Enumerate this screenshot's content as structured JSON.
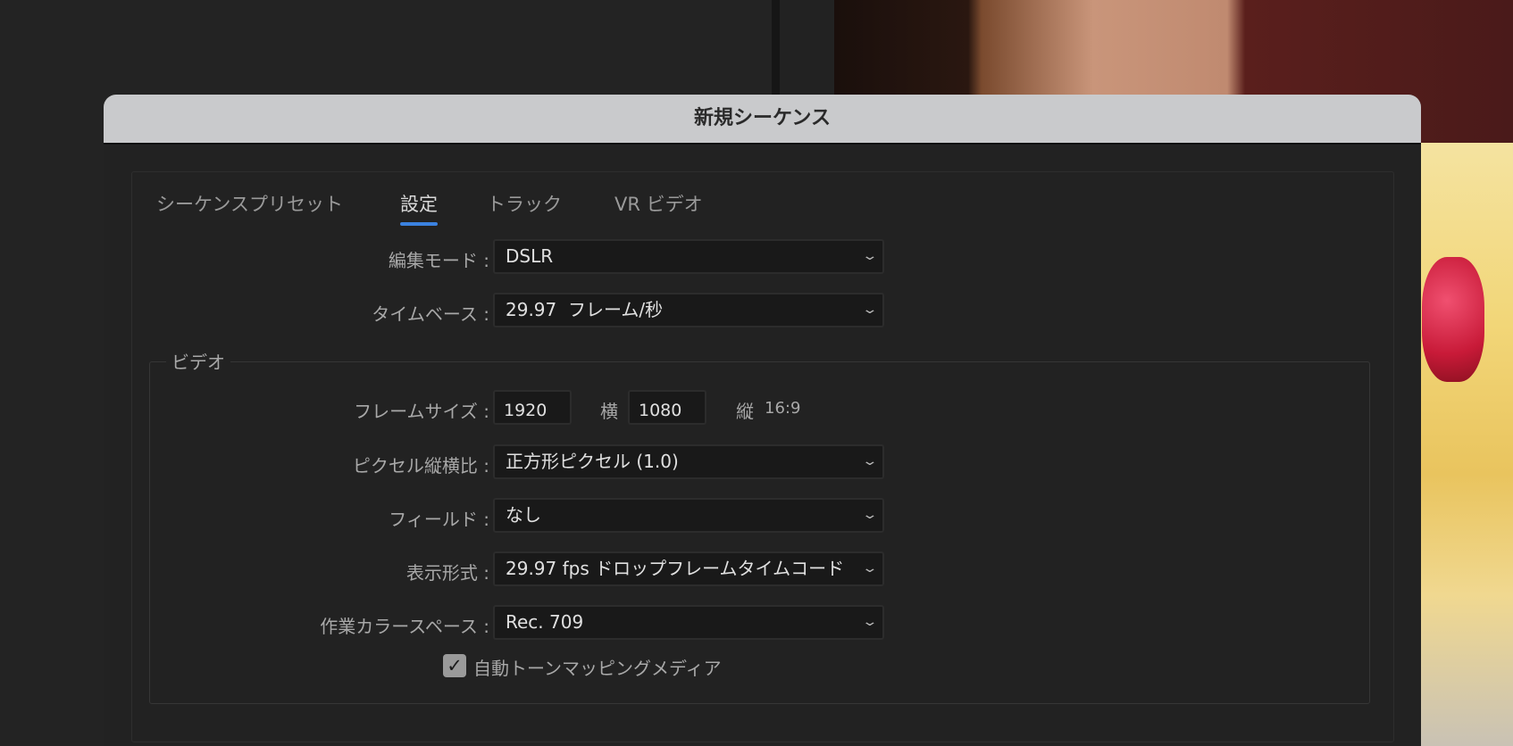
{
  "dialog": {
    "title": "新規シーケンス"
  },
  "tabs": [
    {
      "label": "シーケンスプリセット"
    },
    {
      "label": "設定",
      "active": true
    },
    {
      "label": "トラック"
    },
    {
      "label": "VR ビデオ"
    }
  ],
  "settings": {
    "edit_mode": {
      "label": "編集モード :",
      "value": "DSLR"
    },
    "timebase": {
      "label": "タイムベース :",
      "value": "29.97  フレーム/秒"
    }
  },
  "video": {
    "legend": "ビデオ",
    "frame_size": {
      "label": "フレームサイズ :",
      "width": "1920",
      "width_unit": "横",
      "height": "1080",
      "height_unit": "縦",
      "aspect": "16:9"
    },
    "pixel_aspect": {
      "label": "ピクセル縦横比 :",
      "value": "正方形ピクセル (1.0)"
    },
    "fields": {
      "label": "フィールド :",
      "value": "なし"
    },
    "display_format": {
      "label": "表示形式 :",
      "value": "29.97 fps ドロップフレームタイムコード"
    },
    "color_space": {
      "label": "作業カラースペース :",
      "value": "Rec. 709"
    },
    "auto_tone_map": {
      "label": "自動トーンマッピングメディア",
      "checked": true
    }
  },
  "colors": {
    "accent": "#3b82e0",
    "dialog_bg": "#222222",
    "titlebar": "#c9cacc"
  }
}
